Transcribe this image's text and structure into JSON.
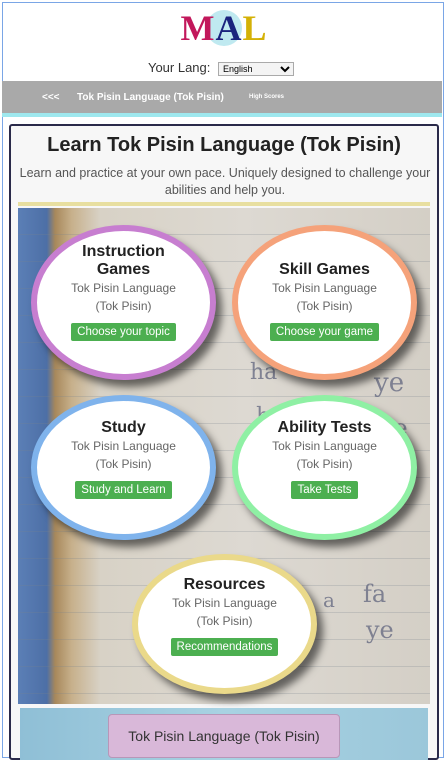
{
  "logo": {
    "letters": [
      "M",
      "A",
      "L"
    ]
  },
  "language_selector": {
    "label": "Your Lang:",
    "selected": "English"
  },
  "navbar": {
    "back_label": "<<<",
    "title": "Tok Pisin Language (Tok Pisin)",
    "high_scores_label": "High Scores"
  },
  "main": {
    "title": "Learn Tok Pisin Language (Tok Pisin)",
    "subtitle": "Learn and practice at your own pace. Uniquely designed to challenge your abilities and help you."
  },
  "cards": [
    {
      "title_line1": "Instruction",
      "title_line2": "Games",
      "lang_line1": "Tok Pisin Language",
      "lang_line2": "(Tok Pisin)",
      "button": "Choose your topic",
      "border_color": "#c77ed0"
    },
    {
      "title_line1": "Skill Games",
      "lang_line1": "Tok Pisin Language",
      "lang_line2": "(Tok Pisin)",
      "button": "Choose your game",
      "border_color": "#f5a27a"
    },
    {
      "title_line1": "Study",
      "lang_line1": "Tok Pisin Language",
      "lang_line2": "(Tok Pisin)",
      "button": "Study and Learn",
      "border_color": "#7fb3ec"
    },
    {
      "title_line1": "Ability Tests",
      "lang_line1": "Tok Pisin Language",
      "lang_line2": "(Tok Pisin)",
      "button": "Take Tests",
      "border_color": "#8ff0a4"
    },
    {
      "title_line1": "Resources",
      "lang_line1": "Tok Pisin Language",
      "lang_line2": "(Tok Pisin)",
      "button": "Recommendations",
      "border_color": "#ead98a"
    }
  ],
  "background_scribbles": [
    "ha",
    "ye",
    "ha",
    "ye",
    "fa",
    "ye",
    "a"
  ],
  "bottom": {
    "button": "Tok Pisin Language (Tok Pisin)"
  }
}
